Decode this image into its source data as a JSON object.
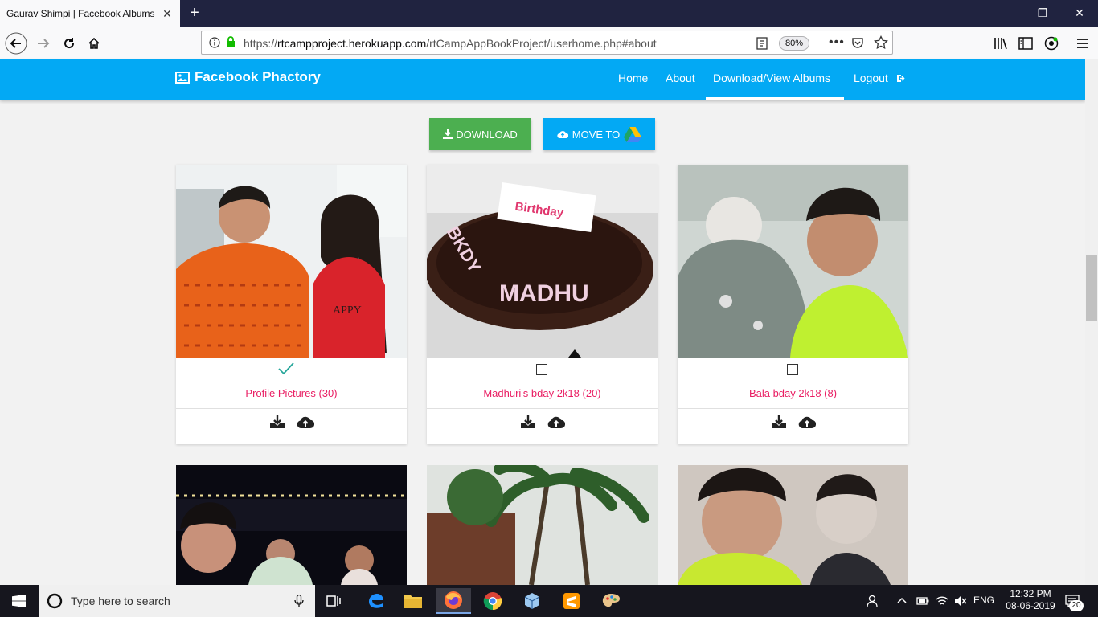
{
  "browser": {
    "tab_title": "Gaurav Shimpi | Facebook Albums",
    "url_prefix": "https://",
    "url_host": "rtcampproject.herokuapp.com",
    "url_path": "/rtCampAppBookProject/userhome.php#about",
    "zoom": "80%"
  },
  "site": {
    "brand": "Facebook Phactory",
    "menu": [
      "Home",
      "About",
      "Download/View Albums",
      "Logout"
    ],
    "active_menu": "Download/View Albums",
    "accent_color": "#03a9f4",
    "download_color": "#4caf50",
    "title_color": "#e91e63"
  },
  "actions": {
    "download_label": "DOWNLOAD",
    "move_label": "MOVE TO"
  },
  "albums": [
    {
      "title": "Profile Pictures (30)",
      "selected": true
    },
    {
      "title": "Madhuri's bday 2k18 (20)",
      "selected": false
    },
    {
      "title": "Bala bday 2k18 (8)",
      "selected": false
    }
  ],
  "taskbar": {
    "search_placeholder": "Type here to search",
    "lang": "ENG",
    "time": "12:32 PM",
    "date": "08-06-2019",
    "notifications": "20"
  }
}
